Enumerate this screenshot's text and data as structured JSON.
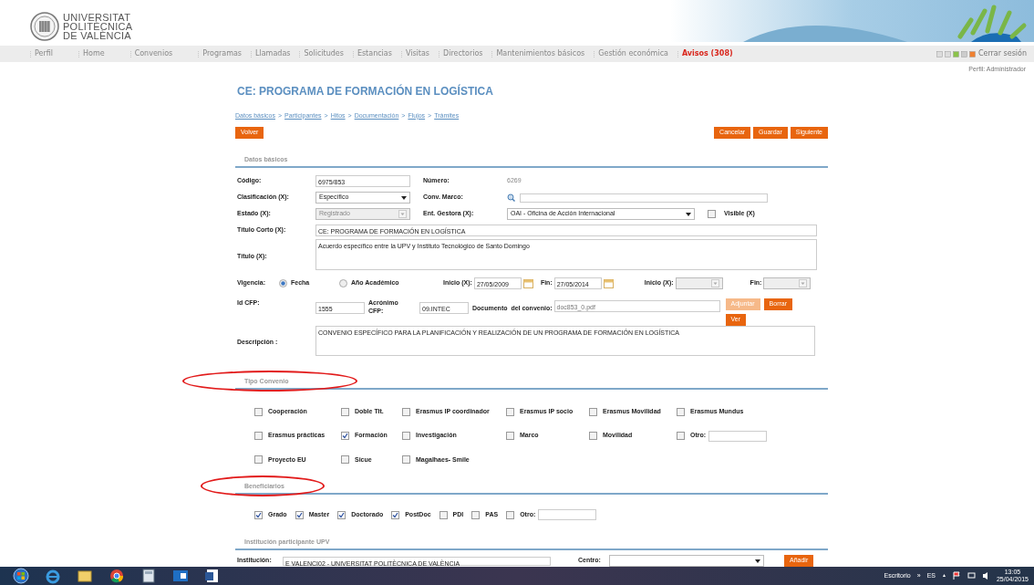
{
  "header": {
    "logo_lines": [
      "UNIVERSITAT",
      "POLITÈCNICA",
      "DE VALÈNCIA"
    ]
  },
  "nav": {
    "items": [
      {
        "label": "Perfil",
        "kind": "link"
      },
      {
        "label": "Home",
        "kind": "link"
      },
      {
        "label": "Convenios",
        "kind": "link"
      },
      {
        "label": "Programas",
        "kind": "link"
      },
      {
        "label": "Llamadas",
        "kind": "link"
      },
      {
        "label": "Solicitudes",
        "kind": "link"
      },
      {
        "label": "Estancias",
        "kind": "link"
      },
      {
        "label": "Visitas",
        "kind": "link"
      },
      {
        "label": "Directorios",
        "kind": "link"
      },
      {
        "label": "Mantenimientos básicos",
        "kind": "link"
      },
      {
        "label": "Gestión económica",
        "kind": "link"
      },
      {
        "label": "Avisos (308)",
        "kind": "alert"
      }
    ],
    "logout": "Cerrar sesión",
    "profile": "Perfil: Administrador"
  },
  "page": {
    "title": "CE: PROGRAMA DE FORMACIÓN EN LOGÍSTICA",
    "breadcrumb": [
      "Datos básicos",
      "Participantes",
      "Hitos",
      "Documentación",
      "Flujos",
      "Trámites"
    ],
    "breadcrumb_separator": ">",
    "left_buttons": [
      "Volver"
    ],
    "right_buttons": [
      "Cancelar",
      "Guardar",
      "Siguiente"
    ]
  },
  "datos_basicos": {
    "title": "Datos básicos",
    "codigo": {
      "label": "Código:",
      "value": "6975/853"
    },
    "numero": {
      "label": "Número:",
      "value": "6269"
    },
    "clasificacion": {
      "label": "Clasificación (X):",
      "value": "Específico",
      "disabled": false
    },
    "conv_marco": {
      "label": "Conv. Marco:"
    },
    "estado": {
      "label": "Estado (X):",
      "value": "Registrado",
      "disabled": true
    },
    "ent_gestora": {
      "label": "Ent. Gestora (X):",
      "value": "OAI - Oficina de Acción Internacional",
      "disabled": false
    },
    "visible": {
      "label": "Visible (X)",
      "checked": false
    },
    "titulo_corto": {
      "label": "Título Corto (X):",
      "value": "CE:  PROGRAMA DE FORMACIÓN  EN LOGÍSTICA"
    },
    "titulo": {
      "label": "Título (X):",
      "value": "Acuerdo específico entre la UPV y Instituto Tecnológico de Santo Domingo"
    },
    "vigencia": {
      "label": "Vigencia:",
      "options": [
        {
          "label": "Fecha",
          "selected": true
        },
        {
          "label": "Año Académico",
          "selected": false
        }
      ]
    },
    "fecha_inicio": {
      "label": "Inicio (X):",
      "value": "27/05/2009"
    },
    "fecha_fin": {
      "label": "Fin:",
      "value": "27/05/2014"
    },
    "curso_inicio": {
      "label": "Inicio (X):",
      "disabled": true
    },
    "curso_fin": {
      "label": "Fin:",
      "disabled": true
    },
    "id_cfp": {
      "label": "Id CFP:",
      "value": "1555"
    },
    "acronimo_cfp": {
      "label": "Acrónimo CFP:",
      "value": "09.INTEC"
    },
    "documento": {
      "label": "Documento  del convenio:",
      "value": "doc853_0.pdf"
    },
    "document_buttons": [
      {
        "label": "Adjuntar",
        "disabled": true
      },
      {
        "label": "Borrar",
        "disabled": false
      },
      {
        "label": "Ver",
        "disabled": false
      }
    ],
    "descripcion": {
      "label": "Descripción :",
      "value": "CONVENIO ESPECÍFICO PARA LA PLANIFICACIÓN Y REALIZACIÓN DE UN PROGRAMA DE FORMACIÓN  EN LOGÍSTICA"
    }
  },
  "tipo_convenio": {
    "title": "Tipo Convenio",
    "options": [
      {
        "label": "Cooperación",
        "checked": false
      },
      {
        "label": "Doble Tit.",
        "checked": false
      },
      {
        "label": "Erasmus IP coordinador",
        "checked": false
      },
      {
        "label": "Erasmus IP socio",
        "checked": false
      },
      {
        "label": "Erasmus Movilidad",
        "checked": false
      },
      {
        "label": "Erasmus Mundus",
        "checked": false
      },
      {
        "label": "Erasmus prácticas",
        "checked": false
      },
      {
        "label": "Formación",
        "checked": true
      },
      {
        "label": "Investigación",
        "checked": false
      },
      {
        "label": "Marco",
        "checked": false
      },
      {
        "label": "Movilidad",
        "checked": false
      },
      {
        "label": "Otro:",
        "checked": false,
        "kind": "other"
      },
      {
        "label": "Proyecto EU",
        "checked": false
      },
      {
        "label": "Sicue",
        "checked": false
      },
      {
        "label": "Magalhaes- Smile",
        "checked": false
      }
    ]
  },
  "beneficiarios": {
    "title": "Beneficiarios",
    "options": [
      {
        "label": "Grado",
        "checked": true
      },
      {
        "label": "Master",
        "checked": true
      },
      {
        "label": "Doctorado",
        "checked": true
      },
      {
        "label": "PostDoc",
        "checked": true
      },
      {
        "label": "PDI",
        "checked": false
      },
      {
        "label": "PAS",
        "checked": false
      },
      {
        "label": "Otro:",
        "checked": false,
        "kind": "other"
      }
    ]
  },
  "institucion": {
    "title": "Institución participante UPV",
    "label": "Institución:",
    "value": "E VALENCI02 - UNIVERSITAT POLITÈCNICA DE VALÈNCIA",
    "centro_label": "Centro:",
    "add_button": "Añadir"
  },
  "taskbar": {
    "desktop": "Escritorio",
    "chevron": "»",
    "language": "ES",
    "tray_arrow": "▲",
    "time": "13:05",
    "date": "25/04/2015"
  }
}
